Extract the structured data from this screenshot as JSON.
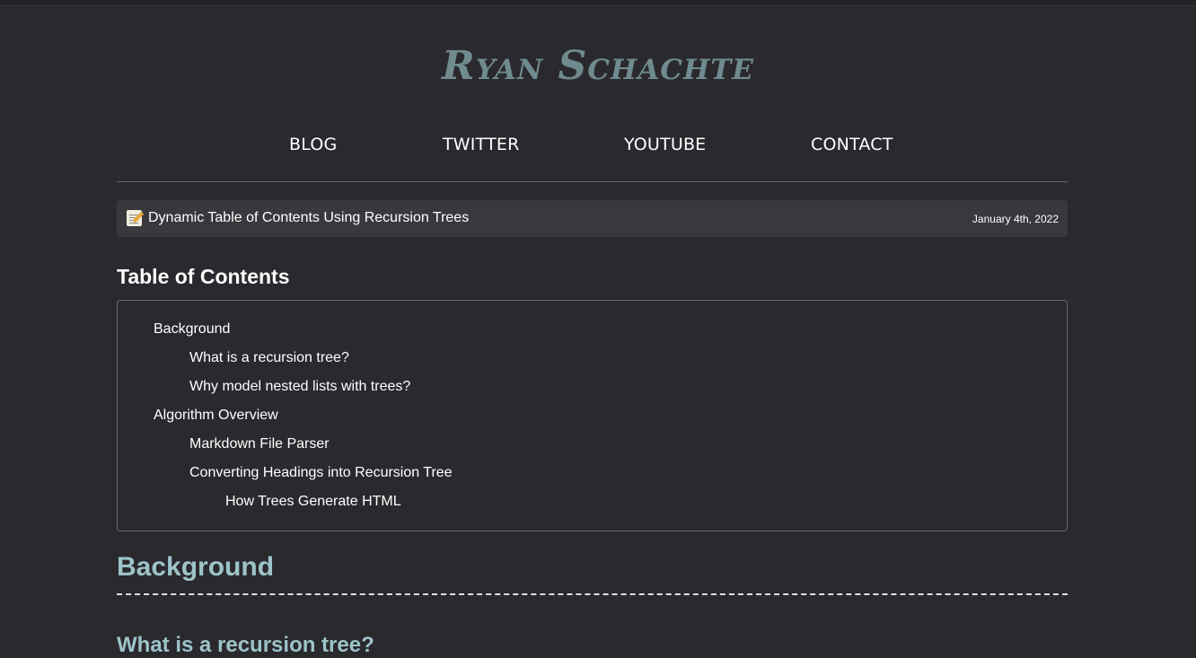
{
  "site": {
    "title": "Ryan Schachte"
  },
  "nav": {
    "items": [
      {
        "label": "BLOG"
      },
      {
        "label": "TWITTER"
      },
      {
        "label": "YOUTUBE"
      },
      {
        "label": "CONTACT"
      }
    ]
  },
  "post": {
    "icon": "memo-icon",
    "title": "Dynamic Table of Contents Using Recursion Trees",
    "date": "January 4th, 2022"
  },
  "toc": {
    "heading": "Table of Contents",
    "items": [
      {
        "label": "Background",
        "level": 1
      },
      {
        "label": "What is a recursion tree?",
        "level": 2
      },
      {
        "label": "Why model nested lists with trees?",
        "level": 2
      },
      {
        "label": "Algorithm Overview",
        "level": 1
      },
      {
        "label": "Markdown File Parser",
        "level": 2
      },
      {
        "label": "Converting Headings into Recursion Tree",
        "level": 2
      },
      {
        "label": "How Trees Generate HTML",
        "level": 3
      }
    ]
  },
  "content": {
    "section_heading": "Background",
    "subsection_heading": "What is a recursion tree?"
  },
  "colors": {
    "background": "#2a292e",
    "title": "#6f8b8f",
    "heading_accent": "#9cc4c9",
    "post_bar": "#39383d"
  }
}
